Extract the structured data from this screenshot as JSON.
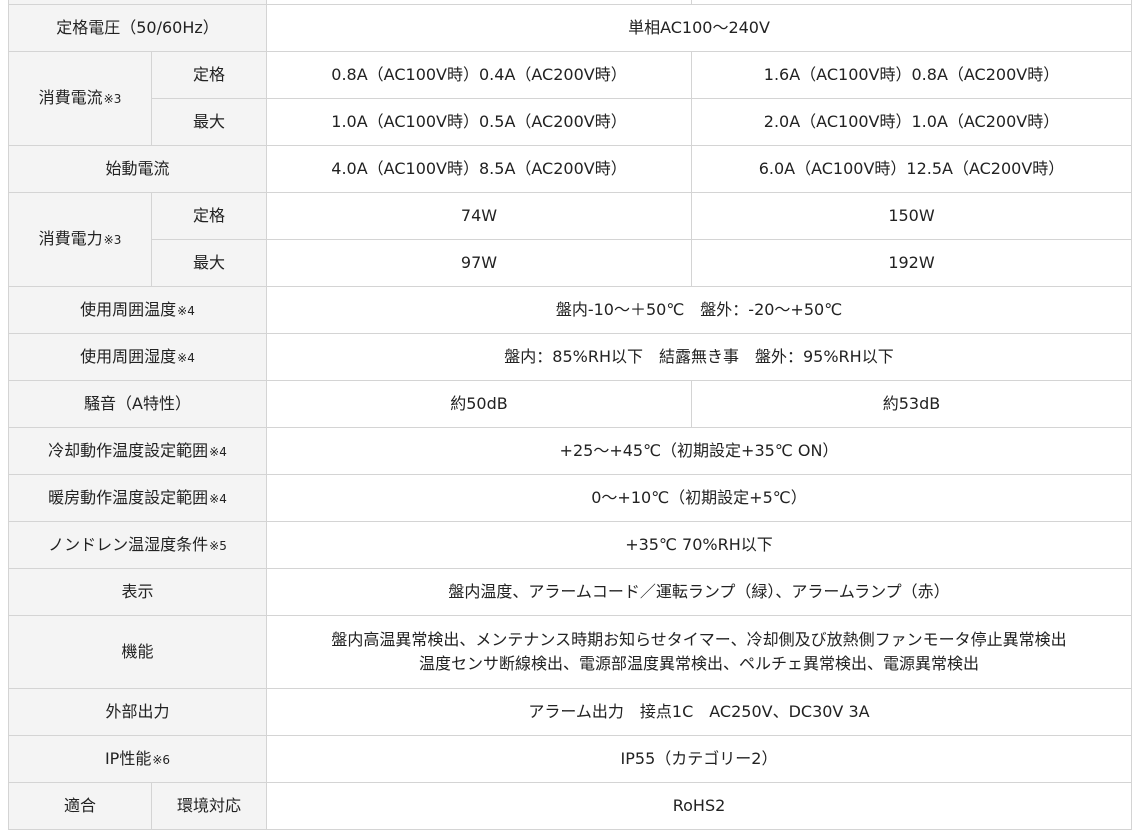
{
  "rows": {
    "voltage": {
      "label": "定格電圧（50/60Hz）",
      "value": "単相AC100～240V"
    },
    "current": {
      "label": "消費電流",
      "note": "※3",
      "rated": {
        "label": "定格",
        "a": "0.8A（AC100V時）0.4A（AC200V時）",
        "b": "1.6A（AC100V時）0.8A（AC200V時）"
      },
      "max": {
        "label": "最大",
        "a": "1.0A（AC100V時）0.5A（AC200V時）",
        "b": "2.0A（AC100V時）1.0A（AC200V時）"
      }
    },
    "inrush": {
      "label": "始動電流",
      "a": "4.0A（AC100V時）8.5A（AC200V時）",
      "b": "6.0A（AC100V時）12.5A（AC200V時）"
    },
    "power": {
      "label": "消費電力",
      "note": "※3",
      "rated": {
        "label": "定格",
        "a": "74W",
        "b": "150W"
      },
      "max": {
        "label": "最大",
        "a": "97W",
        "b": "192W"
      }
    },
    "temp": {
      "label": "使用周囲温度",
      "note": "※4",
      "value": "盤内-10～＋50℃　盤外：-20～+50℃"
    },
    "humidity": {
      "label": "使用周囲湿度",
      "note": "※4",
      "value": "盤内：85%RH以下　結露無き事　盤外：95%RH以下"
    },
    "noise": {
      "label": "騒音（A特性）",
      "a": "約50dB",
      "b": "約53dB"
    },
    "cooling": {
      "label": "冷却動作温度設定範囲",
      "note": "※4",
      "value": "+25～+45℃（初期設定+35℃ ON）"
    },
    "heating": {
      "label": "暖房動作温度設定範囲",
      "note": "※4",
      "value": "0～+10℃（初期設定+5℃）"
    },
    "nondrain": {
      "label": "ノンドレン温湿度条件",
      "note": "※5",
      "value": "+35℃ 70%RH以下"
    },
    "display": {
      "label": "表示",
      "value": "盤内温度、アラームコード／運転ランプ（緑）、アラームランプ（赤）"
    },
    "function": {
      "label": "機能",
      "line1": "盤内高温異常検出、メンテナンス時期お知らせタイマー、冷却側及び放熱側ファンモータ停止異常検出",
      "line2": "温度センサ断線検出、電源部温度異常検出、ペルチェ異常検出、電源異常検出"
    },
    "output": {
      "label": "外部出力",
      "value": "アラーム出力　接点1C　AC250V、DC30V 3A"
    },
    "ip": {
      "label": "IP性能",
      "note": "※6",
      "value": "IP55（カテゴリー2）"
    },
    "compliance": {
      "label": "適合",
      "sub": "環境対応",
      "value": "RoHS2"
    }
  }
}
